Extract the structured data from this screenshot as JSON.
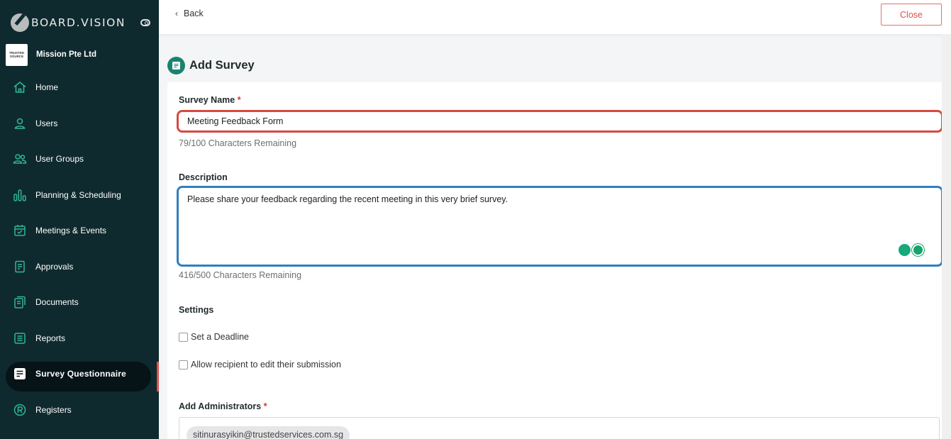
{
  "app": {
    "brand": "BOARD.VISION",
    "org_logo_line1": "TRUSTED",
    "org_logo_line2": "SOURCE",
    "org_name": "Mission Pte Ltd"
  },
  "sidebar": {
    "items": [
      {
        "label": "Home",
        "icon": "home-icon"
      },
      {
        "label": "Users",
        "icon": "user-icon"
      },
      {
        "label": "User Groups",
        "icon": "user-group-icon"
      },
      {
        "label": "Planning & Scheduling",
        "icon": "bar-chart-icon"
      },
      {
        "label": "Meetings & Events",
        "icon": "calendar-check-icon"
      },
      {
        "label": "Approvals",
        "icon": "approval-doc-icon"
      },
      {
        "label": "Documents",
        "icon": "documents-icon"
      },
      {
        "label": "Reports",
        "icon": "report-icon"
      },
      {
        "label": "Survey Questionnaire",
        "icon": "survey-icon",
        "active": true
      },
      {
        "label": "Registers",
        "icon": "registered-icon"
      }
    ]
  },
  "header": {
    "back_label": "Back",
    "close_label": "Close"
  },
  "page": {
    "title": "Add Survey"
  },
  "form": {
    "survey_name_label": "Survey Name",
    "required_mark": "*",
    "survey_name_value": "Meeting Feedback Form",
    "survey_name_hint": "79/100 Characters Remaining",
    "description_label": "Description",
    "description_value": "Please share your feedback regarding the recent meeting in this very brief survey.",
    "description_hint": "416/500 Characters Remaining",
    "settings_title": "Settings",
    "set_deadline_label": "Set a Deadline",
    "allow_edit_label": "Allow recipient to edit their submission",
    "add_admins_label": "Add Administrators",
    "admin_chip": "sitinurasyikin@trustedservices.com.sg"
  },
  "colors": {
    "sidebar_bg": "#0f2a2e",
    "accent_red": "#e0514c",
    "accent_teal": "#1b8270",
    "focus_blue": "#2e7fc0"
  }
}
